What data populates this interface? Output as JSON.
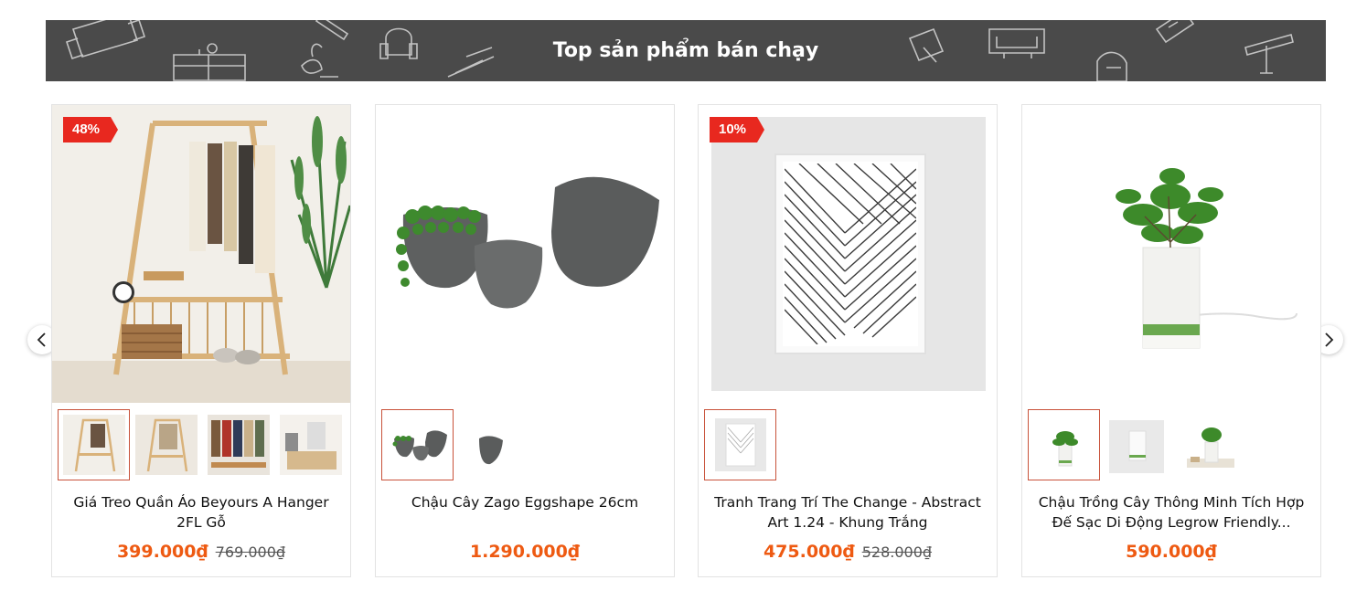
{
  "section": {
    "title": "Top sản phẩm bán chạy",
    "banner_color": "#4a4a4a"
  },
  "nav": {
    "prev_icon": "chevron-left-icon",
    "next_icon": "chevron-right-icon"
  },
  "accent": {
    "price_color": "#ee5a12",
    "badge_color": "#e8281f",
    "active_thumb_border": "#c8523a"
  },
  "products": [
    {
      "badge": "48%",
      "title": "Giá Treo Quần Áo Beyours A Hanger 2FL Gỗ",
      "price": "399.000₫",
      "old_price": "769.000₫",
      "thumb_count": 4,
      "active_thumb": 1
    },
    {
      "badge": "",
      "title": "Chậu Cây Zago Eggshape 26cm",
      "price": "1.290.000₫",
      "old_price": "",
      "thumb_count": 2,
      "active_thumb": 1
    },
    {
      "badge": "10%",
      "title": "Tranh Trang Trí The Change - Abstract Art 1.24 - Khung Trắng",
      "price": "475.000₫",
      "old_price": "528.000₫",
      "thumb_count": 1,
      "active_thumb": 1
    },
    {
      "badge": "",
      "title": "Chậu Trồng Cây Thông Minh Tích Hợp Đế Sạc Di Động Legrow Friendly...",
      "price": "590.000₫",
      "old_price": "",
      "thumb_count": 3,
      "active_thumb": 1
    }
  ]
}
